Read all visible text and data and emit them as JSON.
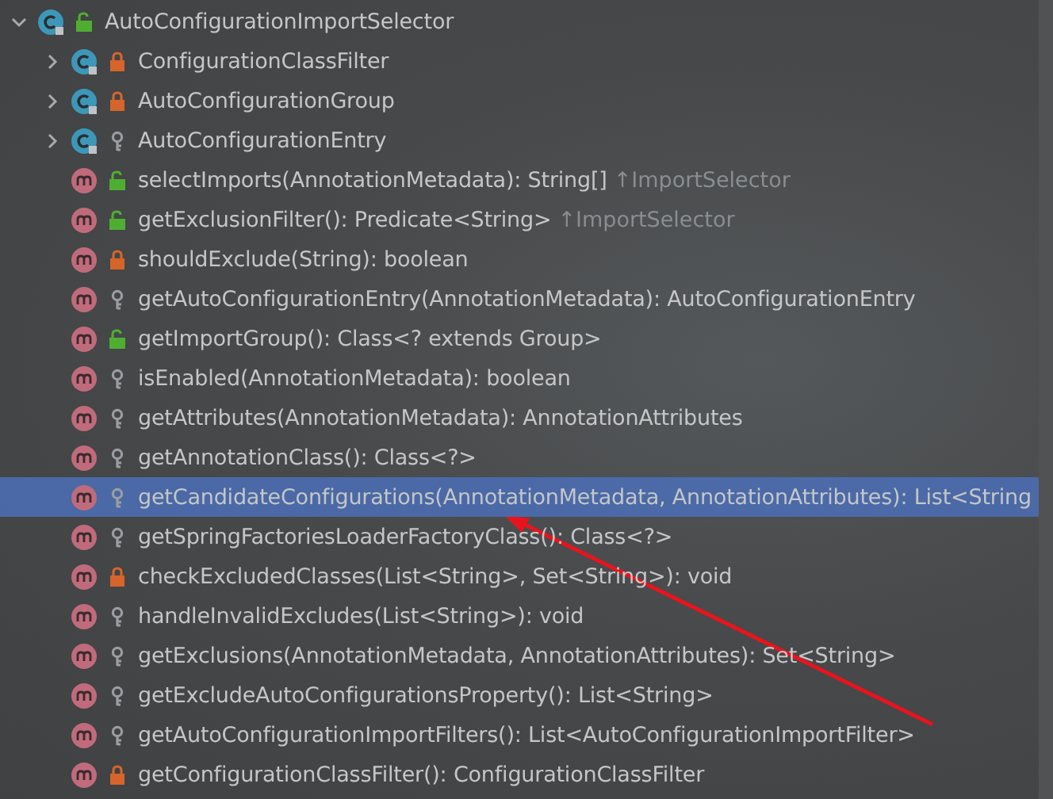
{
  "structure_tree": {
    "name": "AutoConfigurationImportSelector",
    "kind": "class",
    "modifier": {
      "kind": "public"
    },
    "expanded": true,
    "selected": false,
    "children": [
      {
        "name": "ConfigurationClassFilter",
        "kind": "class",
        "modifier": {
          "kind": "private"
        },
        "expanded": false,
        "selected": false
      },
      {
        "name": "AutoConfigurationGroup",
        "kind": "class",
        "modifier": {
          "kind": "private"
        },
        "expanded": false,
        "selected": false
      },
      {
        "name": "AutoConfigurationEntry",
        "kind": "class",
        "modifier": {
          "kind": "package"
        },
        "expanded": false,
        "selected": false
      },
      {
        "name": "selectImports(AnnotationMetadata): String[]",
        "inherited": "↑ImportSelector",
        "kind": "method",
        "modifier": {
          "kind": "public"
        },
        "selected": false
      },
      {
        "name": "getExclusionFilter(): Predicate<String>",
        "inherited": "↑ImportSelector",
        "kind": "method",
        "modifier": {
          "kind": "public"
        },
        "selected": false
      },
      {
        "name": "shouldExclude(String): boolean",
        "kind": "method",
        "modifier": {
          "kind": "private"
        },
        "selected": false
      },
      {
        "name": "getAutoConfigurationEntry(AnnotationMetadata): AutoConfigurationEntry",
        "kind": "method",
        "modifier": {
          "kind": "package"
        },
        "selected": false
      },
      {
        "name": "getImportGroup(): Class<? extends Group>",
        "kind": "method",
        "modifier": {
          "kind": "public"
        },
        "selected": false
      },
      {
        "name": "isEnabled(AnnotationMetadata): boolean",
        "kind": "method",
        "modifier": {
          "kind": "package"
        },
        "selected": false
      },
      {
        "name": "getAttributes(AnnotationMetadata): AnnotationAttributes",
        "kind": "method",
        "modifier": {
          "kind": "package"
        },
        "selected": false
      },
      {
        "name": "getAnnotationClass(): Class<?>",
        "kind": "method",
        "modifier": {
          "kind": "package"
        },
        "selected": false
      },
      {
        "name": "getCandidateConfigurations(AnnotationMetadata, AnnotationAttributes): List<String",
        "kind": "method",
        "modifier": {
          "kind": "package"
        },
        "selected": true
      },
      {
        "name": "getSpringFactoriesLoaderFactoryClass(): Class<?>",
        "kind": "method",
        "modifier": {
          "kind": "package"
        },
        "selected": false
      },
      {
        "name": "checkExcludedClasses(List<String>, Set<String>): void",
        "kind": "method",
        "modifier": {
          "kind": "private"
        },
        "selected": false
      },
      {
        "name": "handleInvalidExcludes(List<String>): void",
        "kind": "method",
        "modifier": {
          "kind": "package"
        },
        "selected": false
      },
      {
        "name": "getExclusions(AnnotationMetadata, AnnotationAttributes): Set<String>",
        "kind": "method",
        "modifier": {
          "kind": "package"
        },
        "selected": false
      },
      {
        "name": "getExcludeAutoConfigurationsProperty(): List<String>",
        "kind": "method",
        "modifier": {
          "kind": "package"
        },
        "selected": false
      },
      {
        "name": "getAutoConfigurationImportFilters(): List<AutoConfigurationImportFilter>",
        "kind": "method",
        "modifier": {
          "kind": "package"
        },
        "selected": false
      },
      {
        "name": "getConfigurationClassFilter(): ConfigurationClassFilter",
        "kind": "method",
        "modifier": {
          "kind": "private"
        },
        "selected": false
      }
    ]
  }
}
